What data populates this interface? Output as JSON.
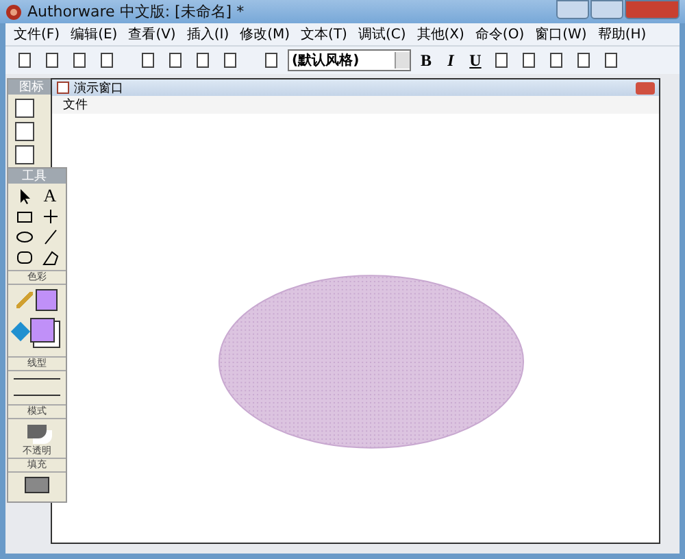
{
  "window": {
    "title": "Authorware 中文版: [未命名] *"
  },
  "menu": [
    "文件(F)",
    "编辑(E)",
    "查看(V)",
    "插入(I)",
    "修改(M)",
    "文本(T)",
    "调试(C)",
    "其他(X)",
    "命令(O)",
    "窗口(W)",
    "帮助(H)"
  ],
  "toolbar": {
    "style_field": "(默认风格)",
    "format_buttons": [
      "B",
      "I",
      "U"
    ]
  },
  "icon_palette": {
    "title": "图标"
  },
  "tools_panel": {
    "title": "工具",
    "text_tool": "A",
    "color_label": "色彩",
    "line_label": "线型",
    "mode_label": "模式",
    "mode_value": "不透明",
    "fill_label": "填充"
  },
  "presentation_window": {
    "title": "演示窗口",
    "menu": [
      "文件"
    ]
  }
}
